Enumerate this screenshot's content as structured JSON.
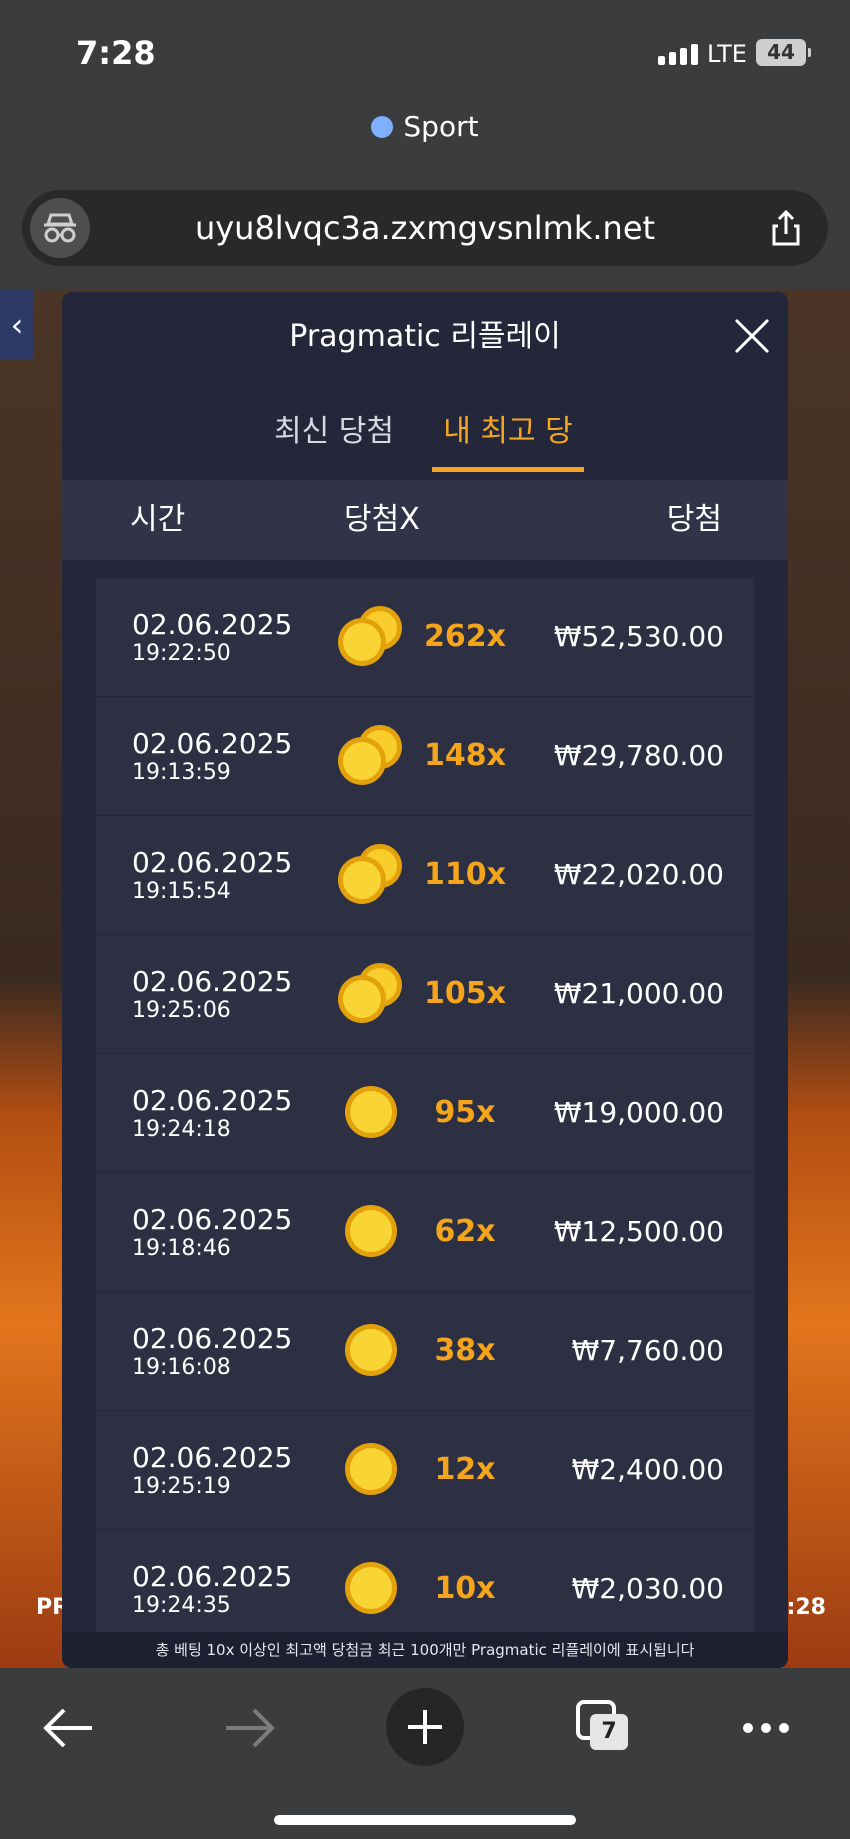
{
  "status_bar": {
    "time": "7:28",
    "network": "LTE",
    "battery": "44"
  },
  "browser": {
    "tab_title": "Sport",
    "url": "uyu8lvqc3a.zxmgvsnlmk.net"
  },
  "modal": {
    "title": "Pragmatic 리플레이",
    "tabs": [
      {
        "label": "최신 당첨",
        "active": false
      },
      {
        "label": "내 최고 당첨",
        "active": true
      }
    ],
    "columns": {
      "time": "시간",
      "multiplier": "당첨X",
      "win": "당첨"
    },
    "rows": [
      {
        "date": "02.06.2025",
        "time": "19:22:50",
        "multiplier": "262x",
        "win": "₩52,530.00"
      },
      {
        "date": "02.06.2025",
        "time": "19:13:59",
        "multiplier": "148x",
        "win": "₩29,780.00"
      },
      {
        "date": "02.06.2025",
        "time": "19:15:54",
        "multiplier": "110x",
        "win": "₩22,020.00"
      },
      {
        "date": "02.06.2025",
        "time": "19:25:06",
        "multiplier": "105x",
        "win": "₩21,000.00"
      },
      {
        "date": "02.06.2025",
        "time": "19:24:18",
        "multiplier": "95x",
        "win": "₩19,000.00"
      },
      {
        "date": "02.06.2025",
        "time": "19:18:46",
        "multiplier": "62x",
        "win": "₩12,500.00"
      },
      {
        "date": "02.06.2025",
        "time": "19:16:08",
        "multiplier": "38x",
        "win": "₩7,760.00"
      },
      {
        "date": "02.06.2025",
        "time": "19:25:19",
        "multiplier": "12x",
        "win": "₩2,400.00"
      },
      {
        "date": "02.06.2025",
        "time": "19:24:35",
        "multiplier": "10x",
        "win": "₩2,030.00"
      }
    ],
    "footnote": "총 베팅 10x 이상인 최고액 당첨금 최근 100개만 Pragmatic 리플레이에 표시됩니다"
  },
  "game_background": {
    "left_label": "PR",
    "right_label": ":28"
  },
  "toolbar": {
    "tab_count": "7"
  },
  "colors": {
    "accent": "#f5a724",
    "modal_bg": "#24273a",
    "row_bg": "#2d3042"
  }
}
